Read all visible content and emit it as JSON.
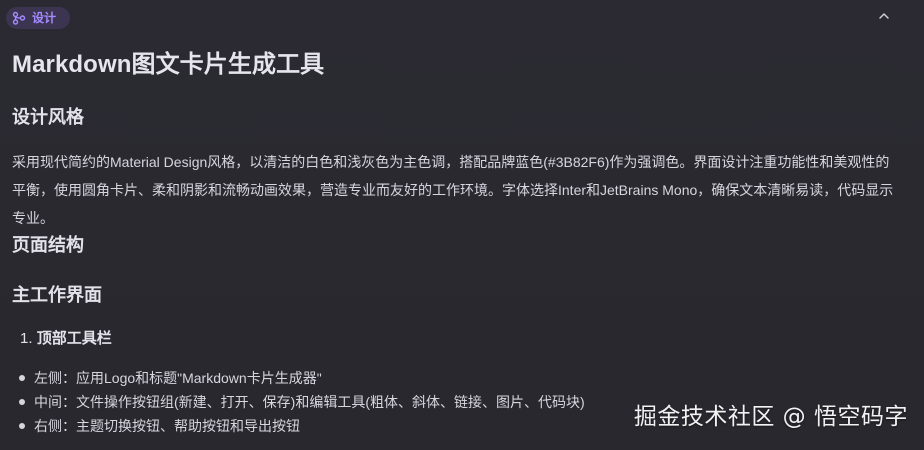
{
  "tag": {
    "label": "设计",
    "icon": "git-branch-icon"
  },
  "collapse_icon": "chevron-up-icon",
  "doc": {
    "title": "Markdown图文卡片生成工具",
    "sections": {
      "design_heading": "设计风格",
      "design_paragraph": "采用现代简约的Material Design风格，以清洁的白色和浅灰色为主色调，搭配品牌蓝色(#3B82F6)作为强调色。界面设计注重功能性和美观性的平衡，使用圆角卡片、柔和阴影和流畅动画效果，营造专业而友好的工作环境。字体选择Inter和JetBrains Mono，确保文本清晰易读，代码显示专业。",
      "structure_heading": "页面结构",
      "main_heading": "主工作界面",
      "ordered_number": "1.",
      "ordered_title": "顶部工具栏",
      "bullets": [
        "左侧：应用Logo和标题\"Markdown卡片生成器\"",
        "中间：文件操作按钮组(新建、打开、保存)和编辑工具(粗体、斜体、链接、图片、代码块)",
        "右侧：主题切换按钮、帮助按钮和导出按钮"
      ]
    }
  },
  "watermark": "掘金技术社区 @ 悟空码字",
  "colors": {
    "background": "#2a2930",
    "tag_text": "#a58bff",
    "tag_bg": "#8968e6",
    "text": "#d7d5de"
  }
}
